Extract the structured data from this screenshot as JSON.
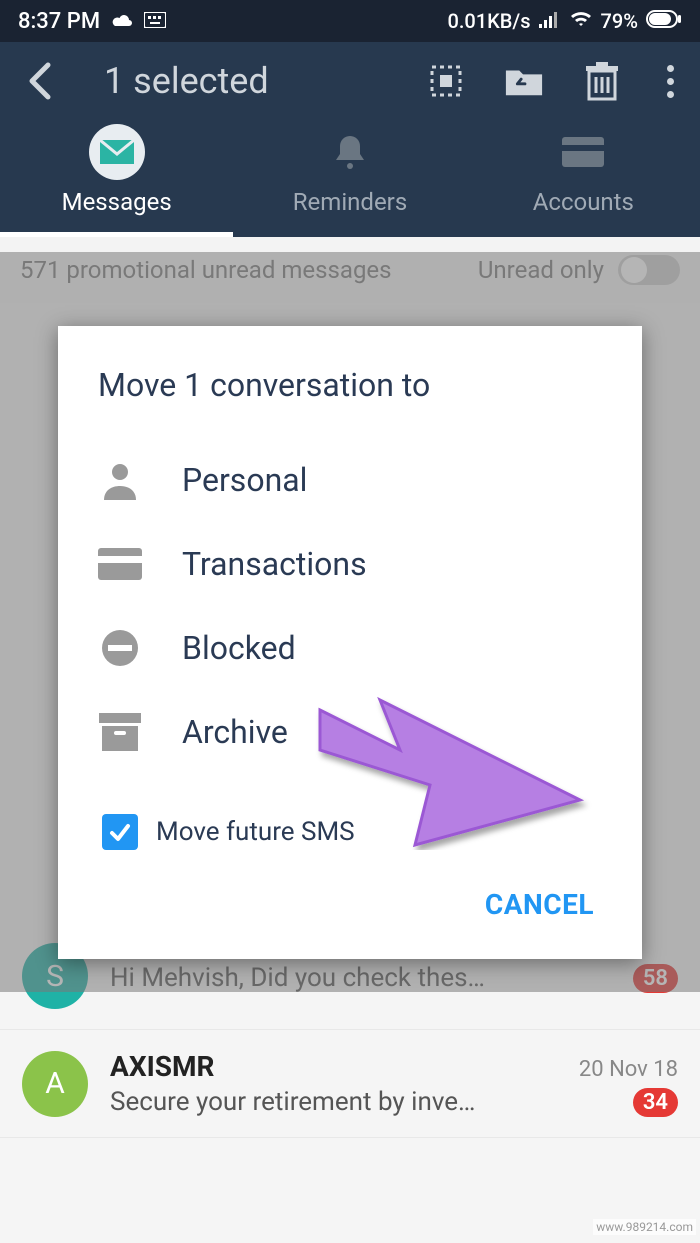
{
  "status": {
    "time": "8:37 PM",
    "net_speed": "0.01KB/s",
    "battery": "79%"
  },
  "app_bar": {
    "title": "1 selected"
  },
  "tabs": {
    "messages": "Messages",
    "reminders": "Reminders",
    "accounts": "Accounts"
  },
  "promo": {
    "text": "571  promotional unread messages",
    "toggle_label": "Unread only"
  },
  "list": [
    {
      "initial": "S",
      "color": "#1fb2a6",
      "name": "",
      "date": "",
      "preview": "Hi Mehvish, Did you check thes…",
      "badge": "58"
    },
    {
      "initial": "A",
      "color": "#8bc34a",
      "name": "AXISMR",
      "date": "20 Nov 18",
      "preview": "Secure your retirement by inve…",
      "badge": "34"
    }
  ],
  "dialog": {
    "title": "Move 1 conversation to",
    "options": {
      "personal": "Personal",
      "transactions": "Transactions",
      "blocked": "Blocked",
      "archive": "Archive"
    },
    "checkbox_label": "Move future SMS",
    "cancel": "CANCEL"
  },
  "watermark": "www.989214.com"
}
